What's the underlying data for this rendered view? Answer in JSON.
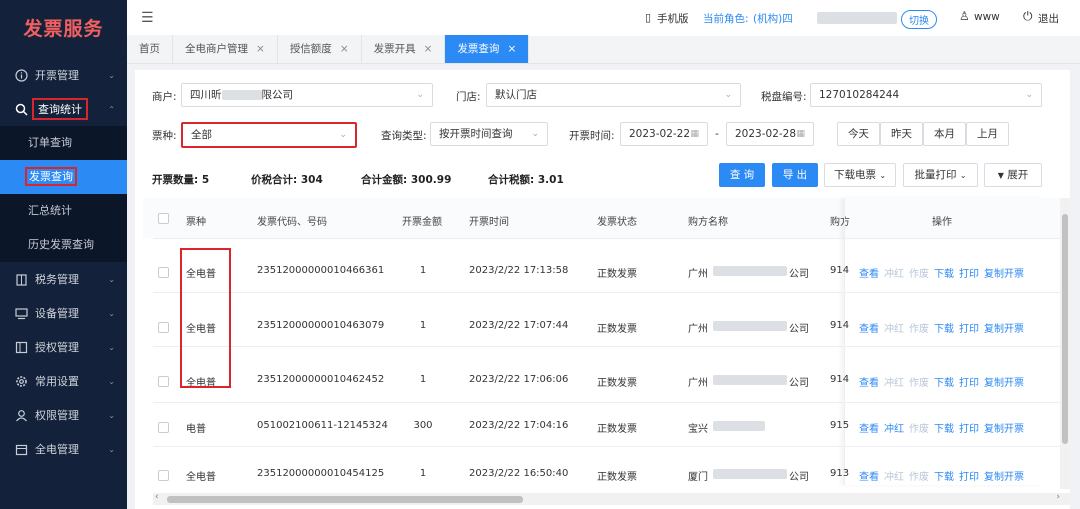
{
  "app": {
    "title": "发票服务"
  },
  "sidebar": {
    "items": [
      {
        "label": "开票管理",
        "icon": "info-circle-icon"
      },
      {
        "label": "查询统计",
        "icon": "search-icon"
      },
      {
        "label": "税务管理",
        "icon": "building-icon"
      },
      {
        "label": "设备管理",
        "icon": "monitor-icon"
      },
      {
        "label": "授权管理",
        "icon": "book-icon"
      },
      {
        "label": "常用设置",
        "icon": "gear-icon"
      },
      {
        "label": "权限管理",
        "icon": "user-icon"
      },
      {
        "label": "全电管理",
        "icon": "calendar-icon"
      }
    ],
    "sub_items": [
      "订单查询",
      "发票查询",
      "汇总统计",
      "历史发票查询"
    ]
  },
  "topbar": {
    "mobile": "手机版",
    "role_label": "当前角色:",
    "role_value": "(机构)四",
    "switch": "切换",
    "user": "www",
    "logout": "退出"
  },
  "tabs": [
    {
      "label": "首页"
    },
    {
      "label": "全电商户管理"
    },
    {
      "label": "授信额度"
    },
    {
      "label": "发票开具"
    },
    {
      "label": "发票查询"
    }
  ],
  "filters": {
    "merchant_label": "商户:",
    "merchant_value": "四川昕",
    "merchant_value_tail": "限公司",
    "store_label": "门店:",
    "store_value": "默认门店",
    "tax_label": "税盘编号:",
    "tax_value": "127010284244",
    "type_label": "票种:",
    "type_value": "全部",
    "query_type_label": "查询类型:",
    "query_type_value": "按开票时间查询",
    "time_label": "开票时间:",
    "date_start": "2023-02-22",
    "date_sep": "-",
    "date_end": "2023-02-28",
    "quick": [
      "今天",
      "昨天",
      "本月",
      "上月"
    ]
  },
  "summary": {
    "count": "开票数量: 5",
    "total_tax_incl": "价税合计: 304",
    "total_amount": "合计金额: 300.99",
    "total_tax": "合计税额: 3.01"
  },
  "actions": {
    "query": "查 询",
    "export": "导 出",
    "download": "下载电票",
    "batch_print": "批量打印",
    "expand": "展开"
  },
  "table": {
    "headers": [
      "票种",
      "发票代码、号码",
      "开票金额",
      "开票时间",
      "发票状态",
      "购方名称",
      "购方",
      "操作"
    ],
    "rows": [
      {
        "type": "全电普",
        "code": "23512000000010466361",
        "amount": "1",
        "time": "2023/2/22 17:13:58",
        "status": "正数发票",
        "buyer": "广州",
        "buyer_tail": "公司",
        "buyer_tax": "914"
      },
      {
        "type": "全电普",
        "code": "23512000000010463079",
        "amount": "1",
        "time": "2023/2/22 17:07:44",
        "status": "正数发票",
        "buyer": "广州",
        "buyer_tail": "公司",
        "buyer_tax": "914"
      },
      {
        "type": "全电普",
        "code": "23512000000010462452",
        "amount": "1",
        "time": "2023/2/22 17:06:06",
        "status": "正数发票",
        "buyer": "广州",
        "buyer_tail": "公司",
        "buyer_tax": "914"
      },
      {
        "type": "电普",
        "code": "051002100611-12145324",
        "amount": "300",
        "time": "2023/2/22 17:04:16",
        "status": "正数发票",
        "buyer": "宝兴",
        "buyer_tail": "",
        "buyer_tax": "915"
      },
      {
        "type": "全电普",
        "code": "23512000000010454125",
        "amount": "1",
        "time": "2023/2/22 16:50:40",
        "status": "正数发票",
        "buyer": "厦门",
        "buyer_tail": "公司",
        "buyer_tax": "913"
      }
    ],
    "ops": [
      "查看",
      "冲红",
      "作废",
      "下载",
      "打印",
      "复制开票"
    ]
  },
  "colors": {
    "sidebar": "#13223a",
    "accent": "#2c8af5",
    "highlight": "#d9262c",
    "logo": "#f06060"
  }
}
